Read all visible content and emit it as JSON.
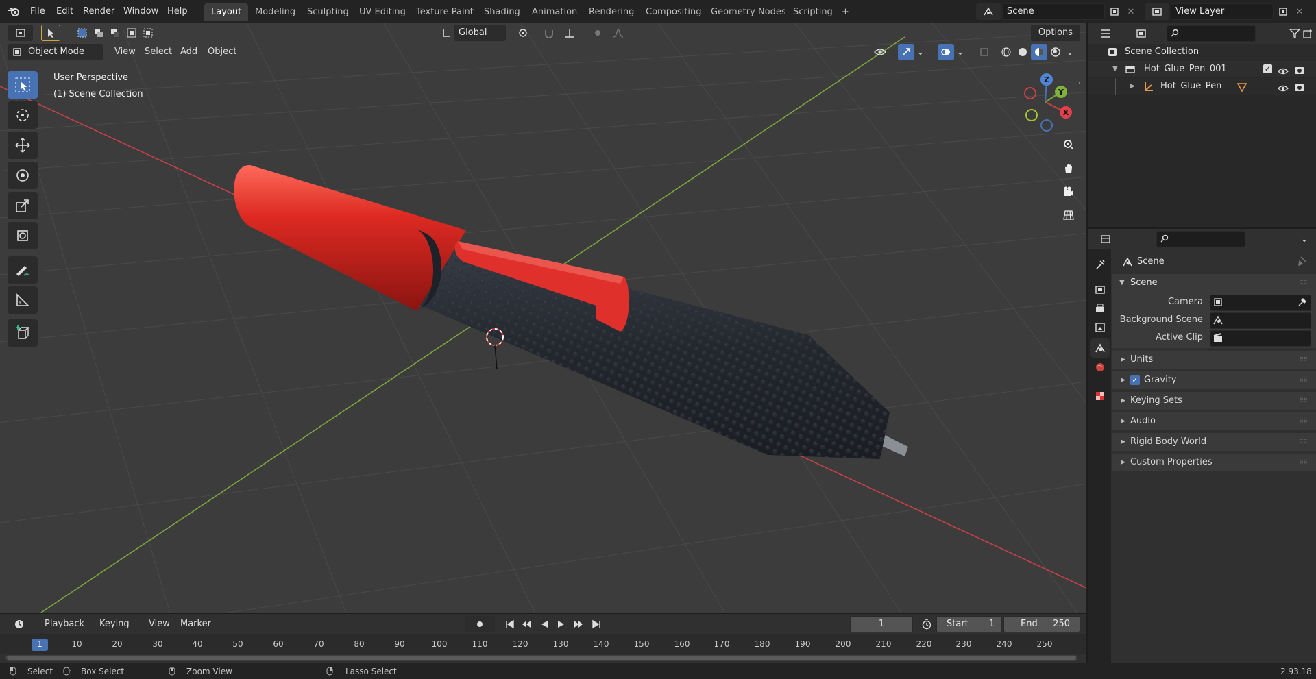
{
  "menu": {
    "items": [
      "File",
      "Edit",
      "Render",
      "Window",
      "Help"
    ]
  },
  "workspaces": {
    "tabs": [
      "Layout",
      "Modeling",
      "Sculpting",
      "UV Editing",
      "Texture Paint",
      "Shading",
      "Animation",
      "Rendering",
      "Compositing",
      "Geometry Nodes",
      "Scripting"
    ],
    "active": "Layout",
    "add_label": "+"
  },
  "scene_selector": {
    "value": "Scene"
  },
  "view_layer_selector": {
    "value": "View Layer"
  },
  "viewport_header": {
    "transform_orientation": "Global",
    "options_label": "Options",
    "mode": "Object Mode",
    "menus": [
      "View",
      "Select",
      "Add",
      "Object"
    ]
  },
  "viewport_overlay": {
    "perspective": "User Perspective",
    "collection": "(1) Scene Collection"
  },
  "gizmo": {
    "x": "X",
    "y": "Y",
    "z": "Z"
  },
  "outliner": {
    "search_placeholder": "",
    "root": "Scene Collection",
    "collection": "Hot_Glue_Pen_001",
    "object": "Hot_Glue_Pen"
  },
  "properties": {
    "search_placeholder": "",
    "context": "Scene",
    "panel_title": "Scene",
    "camera_label": "Camera",
    "background_scene_label": "Background Scene",
    "active_clip_label": "Active Clip",
    "collapsed_panels": [
      "Units",
      "Gravity",
      "Keying Sets",
      "Audio",
      "Rigid Body World",
      "Custom Properties"
    ],
    "gravity_checked": true
  },
  "timeline": {
    "menus": [
      "Playback",
      "Keying",
      "View",
      "Marker"
    ],
    "current_frame": "1",
    "start_label": "Start",
    "start_value": "1",
    "end_label": "End",
    "end_value": "250",
    "ruler": [
      "1",
      "10",
      "20",
      "30",
      "40",
      "50",
      "60",
      "70",
      "80",
      "90",
      "100",
      "110",
      "120",
      "130",
      "140",
      "150",
      "160",
      "170",
      "180",
      "190",
      "200",
      "210",
      "220",
      "230",
      "240",
      "250"
    ]
  },
  "statusbar": {
    "select": "Select",
    "box_select": "Box Select",
    "zoom_view": "Zoom View",
    "lasso_select": "Lasso Select",
    "version": "2.93.18"
  },
  "colors": {
    "accent": "#4772b3",
    "x_axis": "#c94048",
    "y_axis": "#7ea53a",
    "pen_red": "#d42a23",
    "pen_body": "#2a2e35"
  }
}
